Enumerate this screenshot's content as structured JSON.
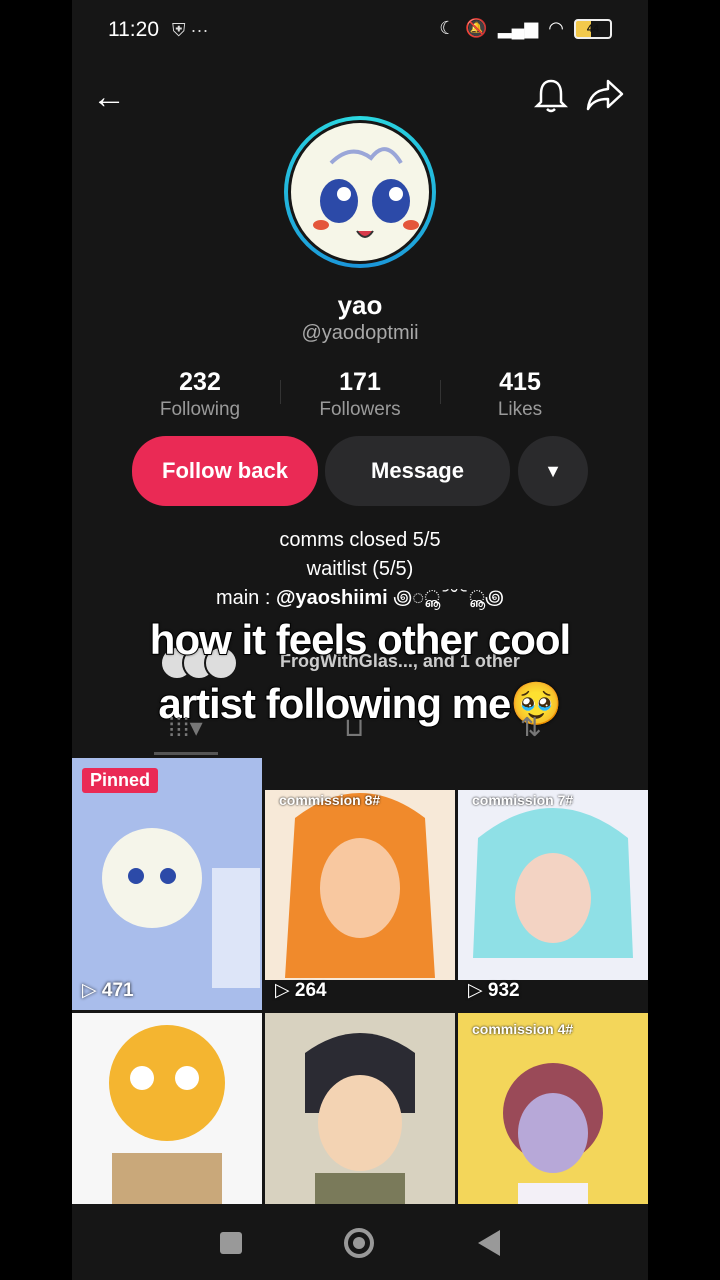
{
  "status": {
    "time": "11:20",
    "left_icons": "⛨ ···",
    "battery": "44"
  },
  "header": {
    "back_icon": "arrow-left-icon",
    "bell_icon": "bell-icon",
    "share_icon": "share-arrow-icon"
  },
  "profile": {
    "name": "yao",
    "handle": "@yaodoptmii"
  },
  "stats": [
    {
      "value": "232",
      "label": "Following"
    },
    {
      "value": "171",
      "label": "Followers"
    },
    {
      "value": "415",
      "label": "Likes"
    }
  ],
  "actions": {
    "follow_back": "Follow back",
    "message": "Message",
    "more": "▼"
  },
  "bio": {
    "line1": "comms closed 5/5",
    "line2": "waitlist (5/5)",
    "line3_prefix": "main : ",
    "line3_handle": "@yaoshiimi",
    "line3_suffix": " ꩜◌ൣ ᷄ ˘ ᷅ ◌ൣ꩜"
  },
  "followed_by": "FrogWithGlas..., and 1 other",
  "caption": {
    "line1": "how it feels other cool",
    "line2": "artist following me🥹"
  },
  "tabs": [
    "grid-icon",
    "lock-icon",
    "repost-icon"
  ],
  "videos": [
    {
      "views": "471",
      "pinned": "Pinned",
      "label": "",
      "bg": "#9fb6e8"
    },
    {
      "views": "264",
      "label": "commission 8#",
      "bg": "#f4a060"
    },
    {
      "views": "932",
      "label": "commission 7#",
      "bg": "#e8e8f4"
    },
    {
      "views": "",
      "label": "",
      "bg": "#f7f7f7"
    },
    {
      "views": "",
      "label": "",
      "bg": "#d8d2c0"
    },
    {
      "views": "",
      "label": "commission 4#",
      "bg": "#f3d65a"
    }
  ]
}
